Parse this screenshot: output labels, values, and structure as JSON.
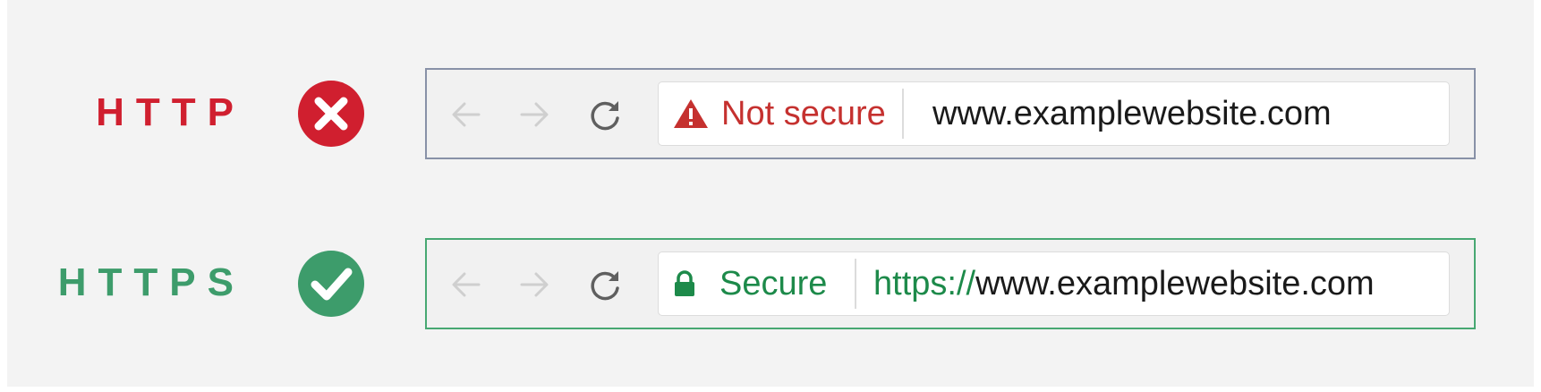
{
  "rows": [
    {
      "protocol_label": "HTTP",
      "status_icon": "error-x-circle-icon",
      "status_color": "#d01f2f",
      "frame_color": "#8891a7",
      "nav": {
        "back_icon": "arrow-left-icon",
        "forward_icon": "arrow-right-icon",
        "reload_icon": "reload-icon"
      },
      "security_chip": {
        "icon": "warning-triangle-icon",
        "text": "Not secure",
        "color": "#c5312f"
      },
      "url": {
        "host": "www.examplewebsite.com"
      }
    },
    {
      "protocol_label": "HTTPS",
      "status_icon": "check-circle-icon",
      "status_color": "#3d9c6b",
      "frame_color": "#47a872",
      "nav": {
        "back_icon": "arrow-left-icon",
        "forward_icon": "arrow-right-icon",
        "reload_icon": "reload-icon"
      },
      "security_chip": {
        "icon": "padlock-icon",
        "text": "Secure",
        "color": "#1d8a4a"
      },
      "url": {
        "scheme": "https://",
        "host": "www.examplewebsite.com"
      }
    }
  ]
}
